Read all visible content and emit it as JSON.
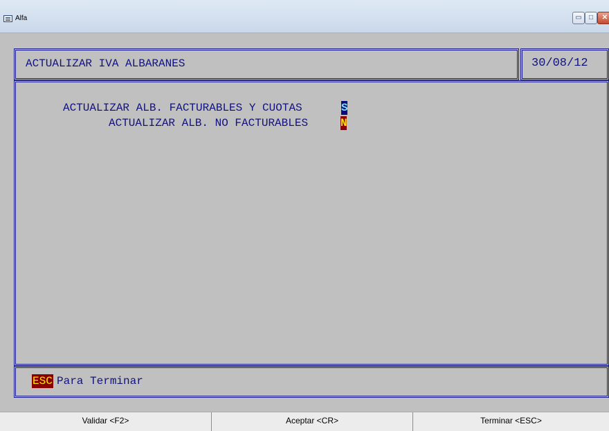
{
  "window": {
    "title": "Alfa",
    "min_glyph": "▭",
    "max_glyph": "□",
    "close_glyph": "✕"
  },
  "header": {
    "title": "ACTUALIZAR IVA ALBARANES",
    "date": "30/08/12"
  },
  "form": {
    "facturables_label": "ACTUALIZAR ALB. FACTURABLES Y CUOTAS",
    "facturables_value": "S",
    "no_facturables_label": "ACTUALIZAR ALB. NO FACTURABLES",
    "no_facturables_value": "N"
  },
  "status": {
    "key": "ESC",
    "text": "Para Terminar"
  },
  "function_keys": [
    {
      "label": "Validar  <F2>"
    },
    {
      "label": "Aceptar  <CR>"
    },
    {
      "label": "Terminar  <ESC>"
    }
  ],
  "colors": {
    "console_bg": "#c0c0c0",
    "frame": "#1c1c8c",
    "text": "#12127a",
    "field_s_bg": "#0b0b7a",
    "field_n_bg": "#8a0000",
    "highlight_fg": "#ffe600"
  }
}
